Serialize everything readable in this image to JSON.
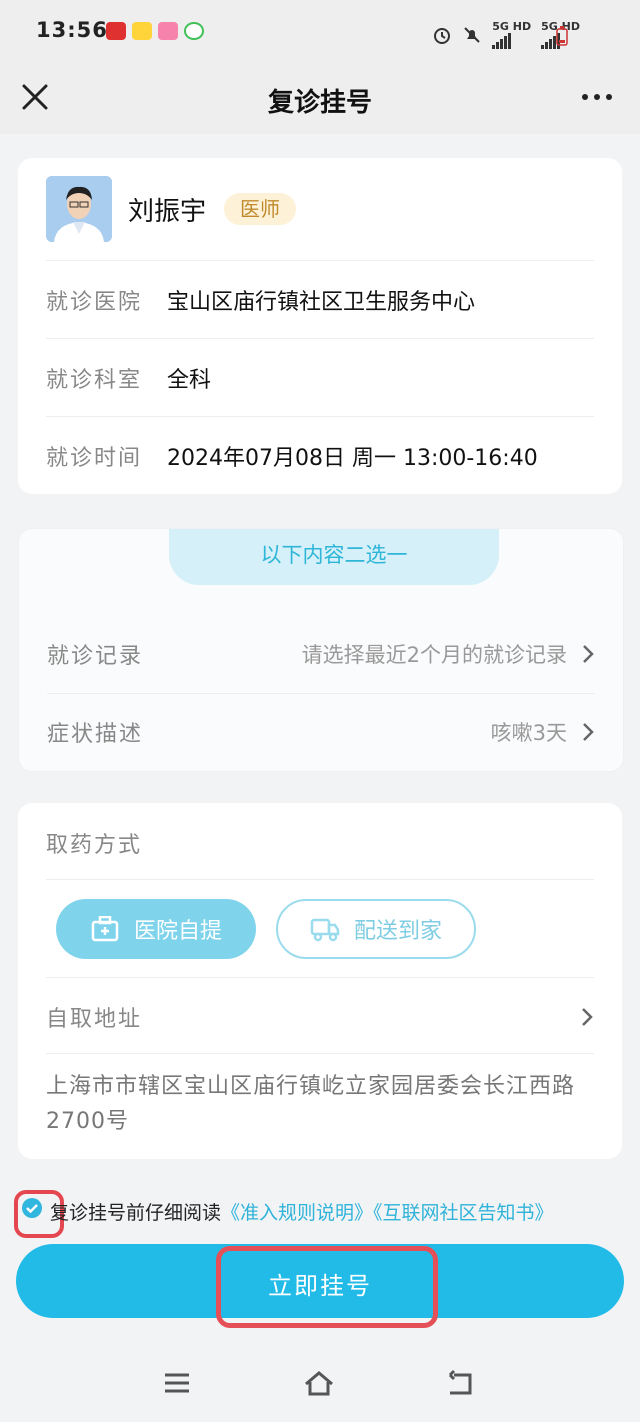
{
  "status_bar": {
    "time": "13:56",
    "app_icons": [
      "app-icon-red",
      "meituan-icon",
      "lala-icon",
      "green-app-icon"
    ],
    "network_1": "5G HD",
    "network_2": "5G HD",
    "icons": [
      "alarm-icon",
      "mute-icon",
      "signal-icon",
      "signal-icon",
      "battery-icon"
    ]
  },
  "nav": {
    "title": "复诊挂号",
    "close_icon": "close-icon",
    "more_icon": "more-icon"
  },
  "doctor": {
    "name": "刘振宇",
    "badge": "医师",
    "hospital_label": "就诊医院",
    "hospital_value": "宝山区庙行镇社区卫生服务中心",
    "dept_label": "就诊科室",
    "dept_value": "全科",
    "time_label": "就诊时间",
    "time_value": "2024年07月08日 周一 13:00-16:40"
  },
  "choice": {
    "tab_label": "以下内容二选一",
    "record_label": "就诊记录",
    "record_value": "请选择最近2个月的就诊记录",
    "symptom_label": "症状描述",
    "symptom_value": "咳嗽3天"
  },
  "medicine": {
    "title": "取药方式",
    "pickup_label": "医院自提",
    "delivery_label": "配送到家",
    "address_label": "自取地址",
    "address_text": "上海市市辖区宝山区庙行镇屹立家园居委会长江西路2700号"
  },
  "agreement": {
    "text": "复诊挂号前仔细阅读",
    "link_1": "《准入规则说明》",
    "link_2": "《互联网社区告知书》",
    "checked": true
  },
  "register_button": {
    "label": "立即挂号"
  },
  "colors": {
    "accent": "#22bbe8",
    "highlight": "#e4474f",
    "badge_bg": "#fdf1d7",
    "badge_text": "#c08a2c"
  }
}
